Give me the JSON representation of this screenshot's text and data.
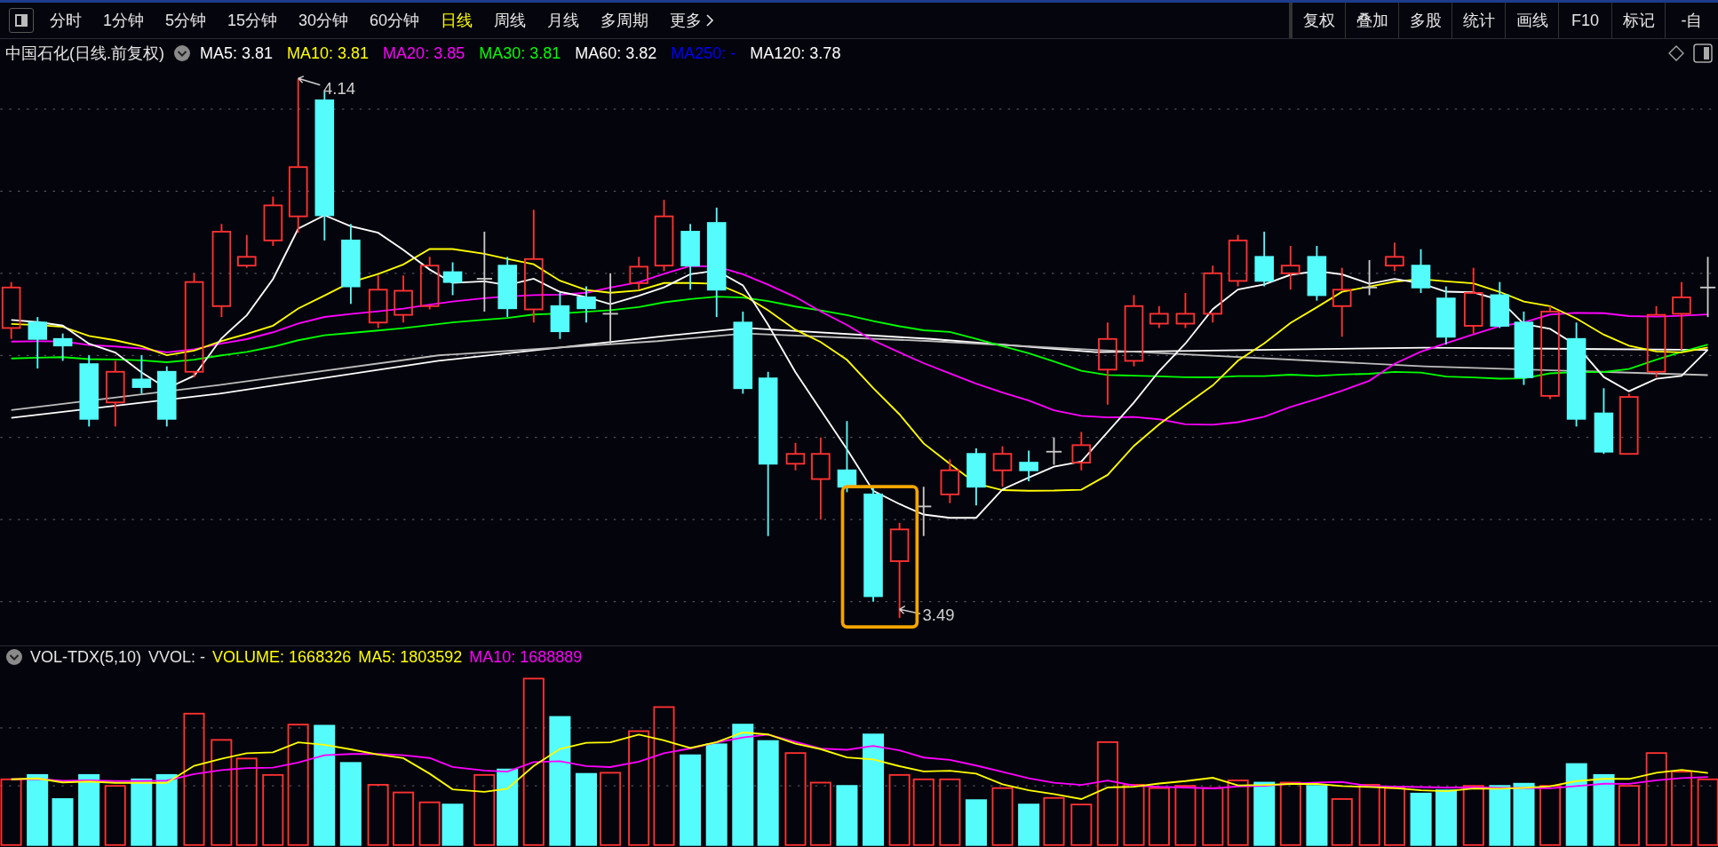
{
  "toolbar": {
    "periods": [
      {
        "label": "分时",
        "selected": false
      },
      {
        "label": "1分钟",
        "selected": false
      },
      {
        "label": "5分钟",
        "selected": false
      },
      {
        "label": "15分钟",
        "selected": false
      },
      {
        "label": "30分钟",
        "selected": false
      },
      {
        "label": "60分钟",
        "selected": false
      },
      {
        "label": "日线",
        "selected": true
      },
      {
        "label": "周线",
        "selected": false
      },
      {
        "label": "月线",
        "selected": false
      },
      {
        "label": "多周期",
        "selected": false
      }
    ],
    "more": "更多",
    "tools": [
      "复权",
      "叠加",
      "多股",
      "统计",
      "画线",
      "F10",
      "标记",
      "-自"
    ]
  },
  "legend": {
    "title": "中国石化(日线.前复权)",
    "indicators": [
      {
        "label": "MA5: 3.81",
        "color": "#ffffff"
      },
      {
        "label": "MA10: 3.81",
        "color": "#ffff00"
      },
      {
        "label": "MA20: 3.85",
        "color": "#ff00ff"
      },
      {
        "label": "MA30: 3.81",
        "color": "#00ff00"
      },
      {
        "label": "MA60: 3.82",
        "color": "#ffffff"
      },
      {
        "label": "MA250: -",
        "color": "#0000ff"
      },
      {
        "label": "MA120: 3.78",
        "color": "#ffffff"
      }
    ]
  },
  "chart": {
    "high_label": "4.14",
    "low_label": "3.49"
  },
  "volume": {
    "title": "VOL-TDX(5,10)",
    "indicators": [
      {
        "label": "VVOL: -",
        "color": "#e0e0e0"
      },
      {
        "label": "VOLUME: 1668326",
        "color": "#ffff00"
      },
      {
        "label": "MA5: 1803592",
        "color": "#ffff00"
      },
      {
        "label": "MA10: 1688889",
        "color": "#ff00ff"
      }
    ]
  }
}
